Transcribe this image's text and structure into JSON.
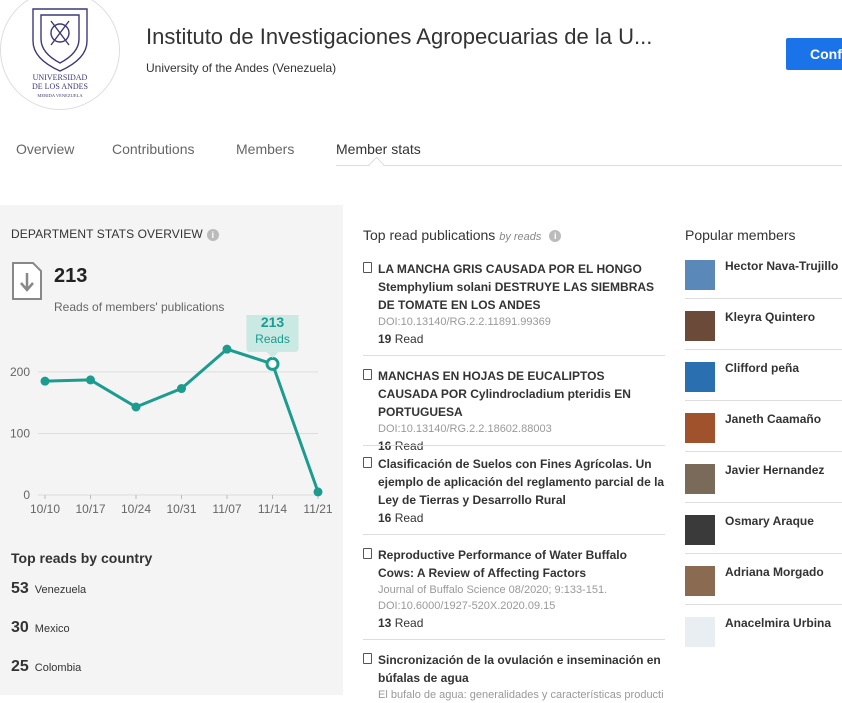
{
  "header": {
    "institution_name": "Instituto de Investigaciones Agropecuarias de la U...",
    "university": "University of the Andes (Venezuela)",
    "logo_text_line1": "UNIVERSIDAD",
    "logo_text_line2": "DE LOS ANDES",
    "logo_text_line3": "MERIDA VENEZUELA",
    "confirm_label": "Confi"
  },
  "tabs": [
    {
      "label": "Overview",
      "active": false
    },
    {
      "label": "Contributions",
      "active": false
    },
    {
      "label": "Members",
      "active": false
    },
    {
      "label": "Member stats",
      "active": true
    }
  ],
  "stats": {
    "title": "DEPARTMENT STATS OVERVIEW",
    "info_icon": "info-icon",
    "reads_total": "213",
    "reads_label": "Reads of members' publications",
    "tooltip_value": "213",
    "tooltip_label": "Reads"
  },
  "chart_data": {
    "type": "line",
    "x": [
      "10/10",
      "10/17",
      "10/24",
      "10/31",
      "11/07",
      "11/14",
      "11/21"
    ],
    "values": [
      185,
      187,
      143,
      173,
      237,
      213,
      5
    ],
    "y_ticks": [
      0,
      100,
      200
    ],
    "ylim": [
      0,
      260
    ],
    "highlight_index": 5,
    "grid": true,
    "color": "#1b9c8f"
  },
  "countries": {
    "title": "Top reads by country",
    "items": [
      {
        "count": "53",
        "name": "Venezuela"
      },
      {
        "count": "30",
        "name": "Mexico"
      },
      {
        "count": "25",
        "name": "Colombia"
      }
    ]
  },
  "publications": {
    "title": "Top read publications",
    "subtitle": "by reads",
    "items": [
      {
        "title": "LA MANCHA GRIS CAUSADA POR EL HONGO Stemphylium solani DESTRUYE LAS SIEMBRAS DE TOMATE EN LOS ANDES",
        "meta": "DOI:10.13140/RG.2.2.11891.99369",
        "reads": "19",
        "reads_label": "Read"
      },
      {
        "title": "MANCHAS EN HOJAS DE EUCALIPTOS CAUSADA POR Cylindrocladium pteridis EN PORTUGUESA",
        "meta": "DOI:10.13140/RG.2.2.18602.88003",
        "reads": "16",
        "reads_label": "Read"
      },
      {
        "title": "Clasificación de Suelos con Fines Agrícolas. Un ejemplo de aplicación del reglamento parcial de la Ley de Tierras y Desarrollo Rural",
        "meta": "",
        "reads": "16",
        "reads_label": "Read"
      },
      {
        "title": "Reproductive Performance of Water Buffalo Cows: A Review of Affecting Factors",
        "meta": "Journal of Buffalo Science 08/2020; 9:133-151. DOI:10.6000/1927-520X.2020.09.15",
        "reads": "13",
        "reads_label": "Read"
      },
      {
        "title": "Sincronización de la ovulación e inseminación en búfalas de agua",
        "meta": "El bufalo de agua: generalidades y características producti",
        "reads": "",
        "reads_label": ""
      }
    ]
  },
  "members": {
    "title": "Popular members",
    "items": [
      {
        "name": "Hector Nava-Trujillo",
        "avatar_color": "#5a88b8"
      },
      {
        "name": "Kleyra Quintero",
        "avatar_color": "#6b4a3a"
      },
      {
        "name": "Clifford peña",
        "avatar_color": "#2a6fb0"
      },
      {
        "name": "Janeth Caamaño",
        "avatar_color": "#a0522d"
      },
      {
        "name": "Javier Hernandez",
        "avatar_color": "#7a6a5a"
      },
      {
        "name": "Osmary Araque",
        "avatar_color": "#3a3a3a"
      },
      {
        "name": "Adriana Morgado",
        "avatar_color": "#8a6a50"
      },
      {
        "name": "Anacelmira Urbina",
        "avatar_color": "#e8eef2"
      }
    ]
  }
}
